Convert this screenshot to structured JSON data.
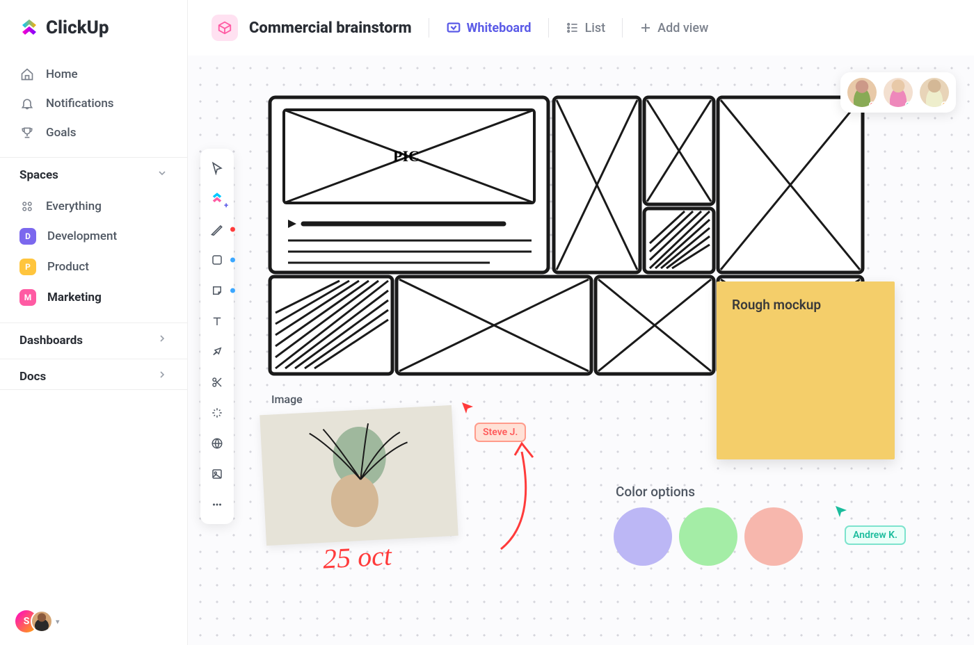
{
  "app": {
    "name": "ClickUp"
  },
  "sidebar": {
    "nav": [
      {
        "label": "Home",
        "icon": "home"
      },
      {
        "label": "Notifications",
        "icon": "bell"
      },
      {
        "label": "Goals",
        "icon": "trophy"
      }
    ],
    "spaces_header": "Spaces",
    "spaces": [
      {
        "label": "Everything",
        "icon": "dots",
        "badge": null
      },
      {
        "label": "Development",
        "badge": "D",
        "color": "#7b68ee"
      },
      {
        "label": "Product",
        "badge": "P",
        "color": "#ffc53d"
      },
      {
        "label": "Marketing",
        "badge": "M",
        "color": "#ff5ba3",
        "active": true
      }
    ],
    "dashboards": "Dashboards",
    "docs": "Docs",
    "user_initial": "S"
  },
  "header": {
    "title": "Commercial brainstorm",
    "views": [
      {
        "label": "Whiteboard",
        "icon": "whiteboard",
        "active": true
      },
      {
        "label": "List",
        "icon": "list",
        "active": false
      }
    ],
    "add_view": "Add view"
  },
  "canvas": {
    "sketch_pic_label": "PIC",
    "sticky_note": "Rough mockup",
    "image_label": "Image",
    "handwritten_date": "25 oct",
    "color_options_label": "Color options",
    "color_swatches": [
      "#bcb7f5",
      "#a4eda6",
      "#f7b7ad"
    ],
    "cursors": [
      {
        "name": "Steve J.",
        "color": "#ff5b5b",
        "bg": "#ffe1d6"
      },
      {
        "name": "Andrew K.",
        "color": "#1abc9c",
        "bg": "#d6fff4"
      }
    ],
    "collaborators": [
      {
        "status": "#ff3b3b"
      },
      {
        "status": "#1abc9c"
      },
      {
        "status": "#ff9f1a"
      }
    ]
  }
}
